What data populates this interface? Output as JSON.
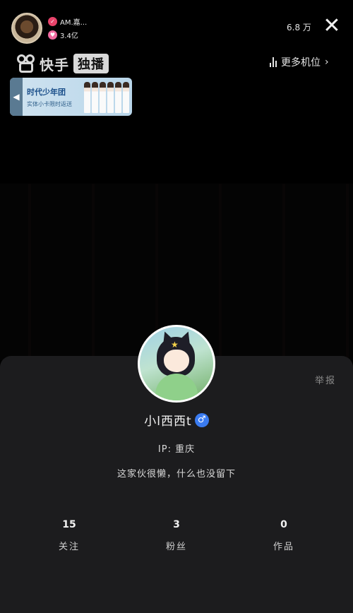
{
  "streamer": {
    "name": "AM.嘉...",
    "likes": "3.4亿"
  },
  "viewers": "6.8 万",
  "brand": {
    "name": "快手",
    "tag": "独播"
  },
  "more_positions_label": "更多机位",
  "banner": {
    "title": "时代少年团",
    "subtitle": "实体小卡限时返送"
  },
  "profile": {
    "report_label": "举报",
    "username": "小l西西t",
    "gender_symbol": "♂",
    "ip": "IP: 重庆",
    "bio": "这家伙很懒，什么也没留下",
    "stats": [
      {
        "value": "15",
        "label": "关注"
      },
      {
        "value": "3",
        "label": "粉丝"
      },
      {
        "value": "0",
        "label": "作品"
      }
    ]
  },
  "colors": {
    "card_background": "#1c1c1e",
    "gender_badge": "#3a7bf0",
    "like_badge": "#e8436a"
  }
}
